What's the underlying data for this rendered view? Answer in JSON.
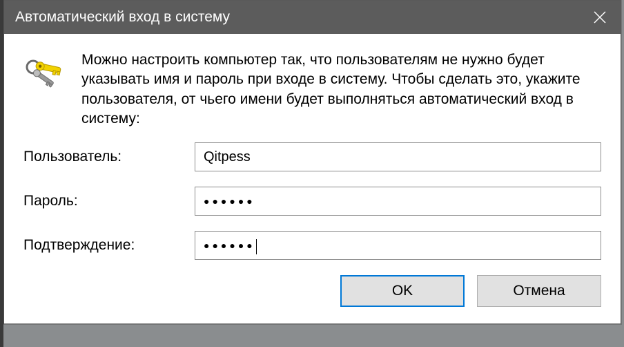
{
  "titlebar": {
    "title": "Автоматический вход в систему"
  },
  "description": "Можно настроить компьютер так, что пользователям не нужно будет указывать имя и пароль при входе в систему. Чтобы сделать это, укажите пользователя, от чьего имени будет выполняться автоматический вход в систему:",
  "fields": {
    "user_label": "Пользователь:",
    "user_value": "Qitpess",
    "password_label": "Пароль:",
    "password_value": "●●●●●●",
    "confirm_label": "Подтверждение:",
    "confirm_value": "●●●●●●"
  },
  "buttons": {
    "ok": "OK",
    "cancel": "Отмена"
  }
}
